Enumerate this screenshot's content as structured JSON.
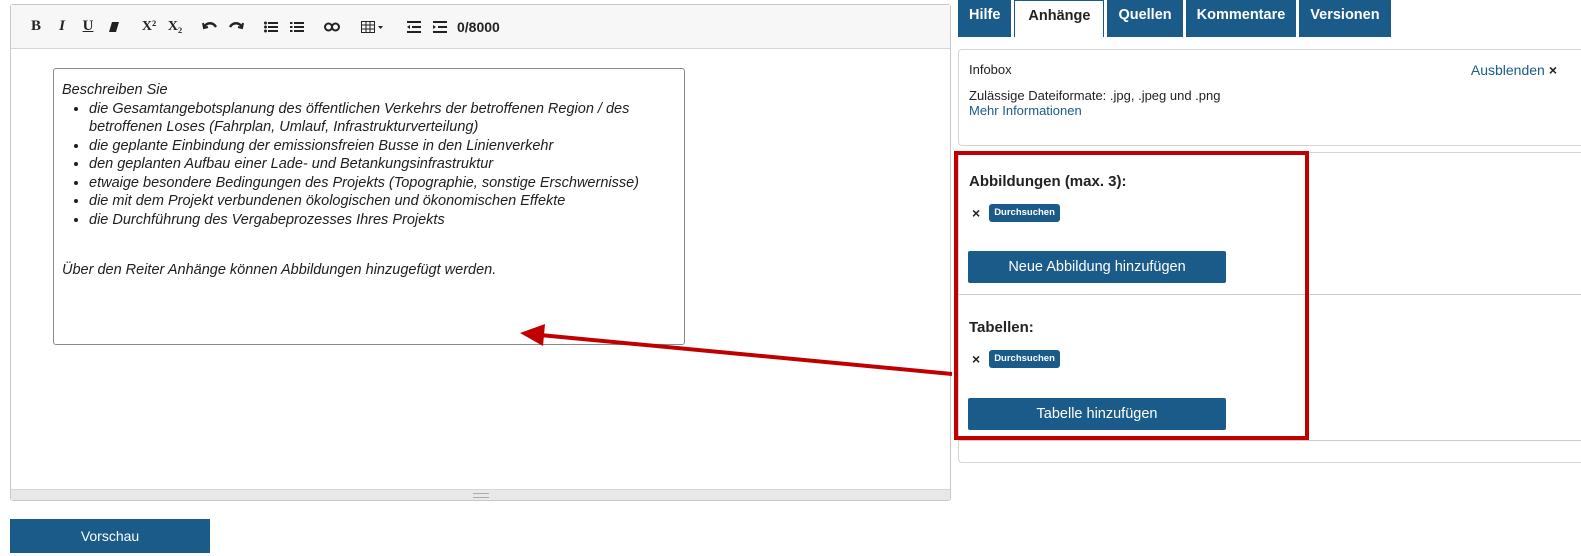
{
  "editor": {
    "toolbar": {
      "bold": "B",
      "italic": "I",
      "underline": "U",
      "superscript": "X²",
      "subscript": "X₂",
      "char_count": "0/8000"
    },
    "hint": {
      "intro": "Beschreiben Sie",
      "items": [
        "die Gesamtangebotsplanung des öffentlichen Verkehrs der betroffenen Region / des betroffenen Loses (Fahrplan, Umlauf, Infrastrukturverteilung)",
        "die geplante Einbindung der emissionsfreien Busse in den Linienverkehr",
        "den geplanten Aufbau einer Lade- und Betankungsinfrastruktur",
        "etwaige besondere Bedingungen des Projekts (Topographie, sonstige Erschwernisse)",
        "die mit dem Projekt verbundenen ökologischen und ökonomischen Effekte",
        "die Durchführung des Vergabeprozesses Ihres Projekts"
      ],
      "footer": "Über den Reiter Anhänge können Abbildungen hinzugefügt werden."
    },
    "preview_label": "Vorschau"
  },
  "tabs": [
    {
      "label": "Hilfe",
      "active": false
    },
    {
      "label": "Anhänge",
      "active": true
    },
    {
      "label": "Quellen",
      "active": false
    },
    {
      "label": "Kommentare",
      "active": false
    },
    {
      "label": "Versionen",
      "active": false
    }
  ],
  "infobox": {
    "title": "Infobox",
    "hide_label": "Ausblenden",
    "hide_icon": "×",
    "text": "Zulässige Dateiformate: .jpg, .jpeg und .png",
    "link": "Mehr Informationen"
  },
  "attachments": {
    "images": {
      "title": "Abbildungen (max. 3):",
      "remove_icon": "×",
      "browse_label": "Durchsuchen",
      "add_label": "Neue Abbildung hinzufügen"
    },
    "tables": {
      "title": "Tabellen:",
      "remove_icon": "×",
      "browse_label": "Durchsuchen",
      "add_label": "Tabelle hinzufügen"
    }
  },
  "colors": {
    "brand_blue": "#1a5b8a",
    "annotation_red": "#c00000"
  }
}
